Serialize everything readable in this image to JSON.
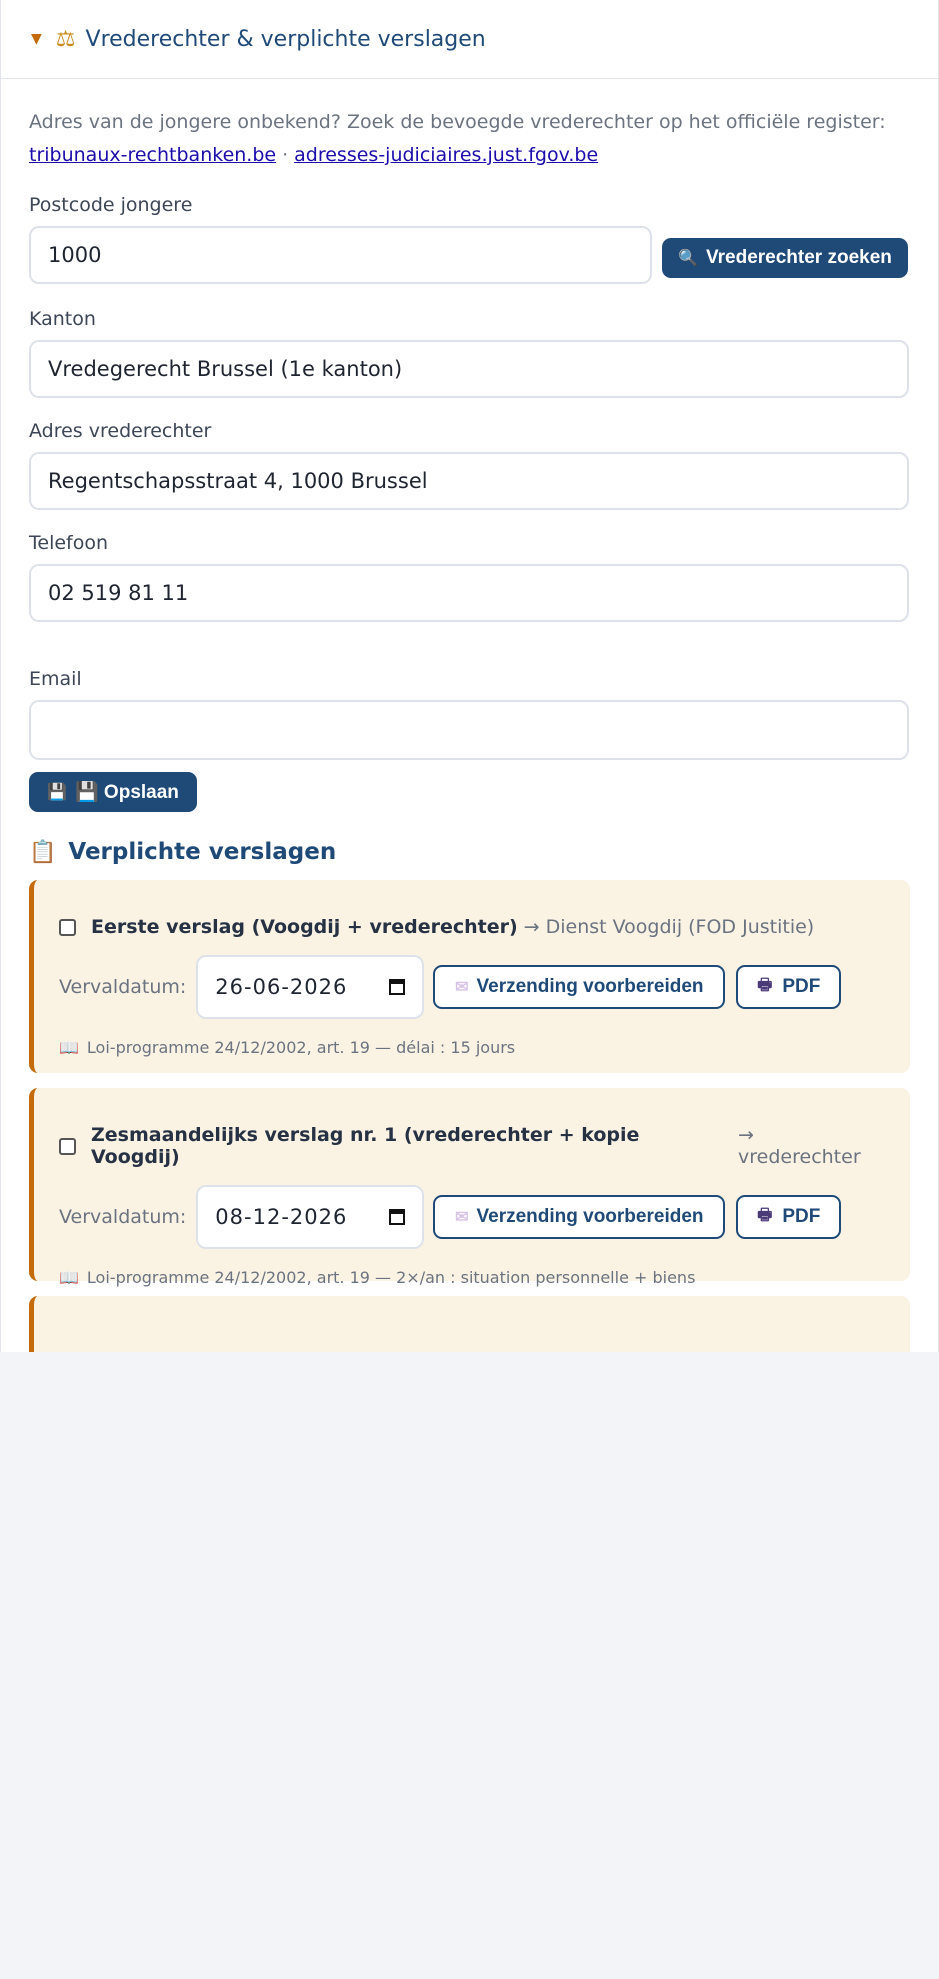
{
  "panel": {
    "title": "Vrederechter & verplichte verslagen",
    "caret_icon": "caret-down-icon",
    "title_icon": "scale-icon"
  },
  "intro": {
    "text": "Adres van de jongere onbekend? Zoek de bevoegde vrederechter op het officiële register:",
    "link1": "tribunaux-rechtbanken.be",
    "separator": "·",
    "link2": "adresses-judiciaires.just.fgov.be"
  },
  "form": {
    "postcode_label": "Postcode jongere",
    "postcode_value": "1000",
    "search_button": "Vrederechter zoeken",
    "kanton_label": "Kanton",
    "kanton_value": "Vredegerecht Brussel (1e kanton)",
    "adres_label": "Adres vrederechter",
    "adres_value": "Regentschapsstraat 4, 1000 Brussel",
    "telefoon_label": "Telefoon",
    "telefoon_value": "02 519 81 11",
    "email_label": "Email",
    "email_value": "",
    "save_button": "💾 Opslaan"
  },
  "reports": {
    "section_title": "Verplichte verslagen",
    "section_icon": "clipboard-icon",
    "due_label": "Vervaldatum:",
    "prepare_button": "Verzending voorbereiden",
    "pdf_button": "PDF",
    "items": [
      {
        "title": "Eerste verslag (Voogdij + vrederechter)",
        "recipient": "→ Dienst Voogdij (FOD Justitie)",
        "due_date": "26-06-2026",
        "reference": "Loi-programme 24/12/2002, art. 19 — délai : 15 jours",
        "checked": false
      },
      {
        "title": "Zesmaandelijks verslag nr. 1 (vrederechter + kopie Voogdij)",
        "recipient": "→ vrederechter",
        "due_date": "08-12-2026",
        "reference": "Loi-programme 24/12/2002, art. 19 — 2×/an : situation personnelle + biens",
        "checked": false
      }
    ]
  },
  "colors": {
    "brand": "#1f4a78",
    "accent": "#c46b0e",
    "card_bg": "#faf3e4",
    "page_bg": "#f3f4f7"
  }
}
